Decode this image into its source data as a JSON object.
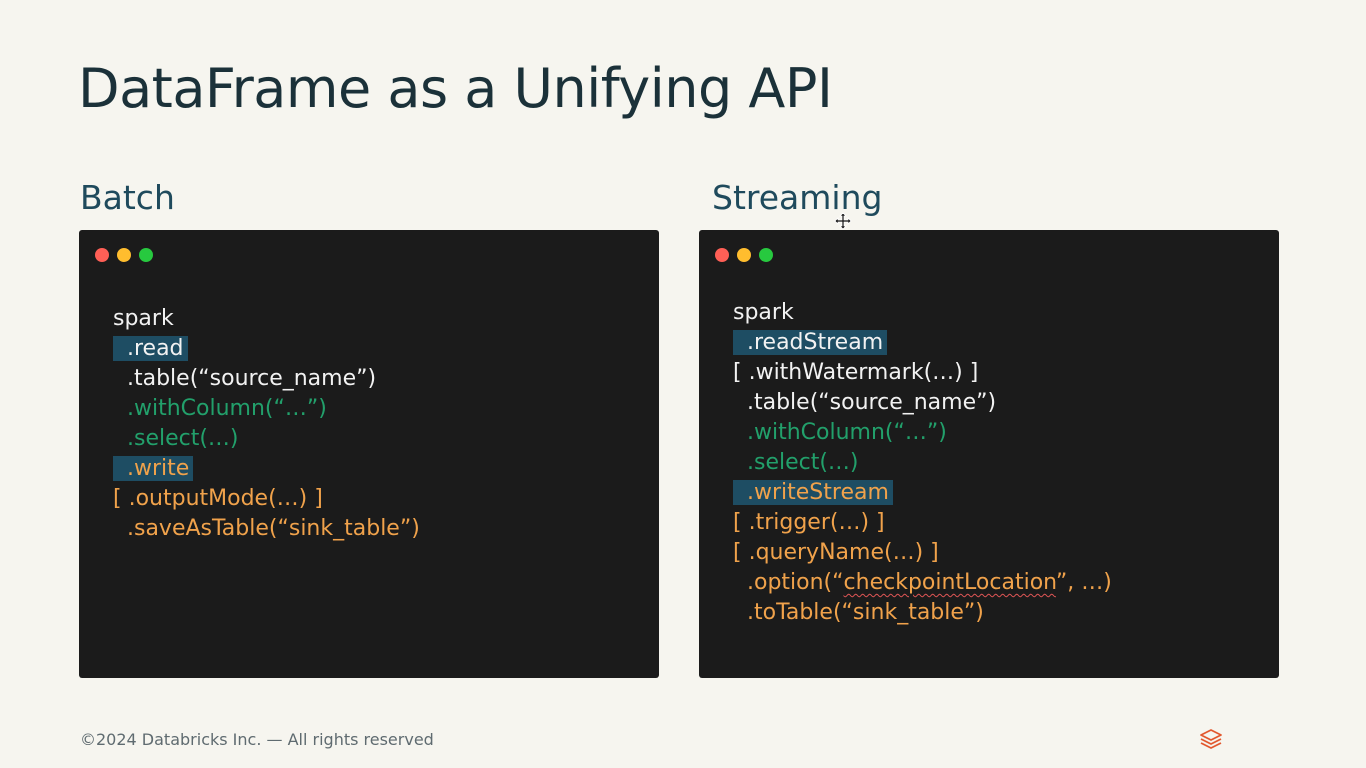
{
  "slide": {
    "title": "DataFrame as a Unifying API",
    "footer": "©2024 Databricks Inc. — All rights reserved",
    "logo_icon": "databricks-logo-icon"
  },
  "colors": {
    "background": "#f6f5ef",
    "title": "#1b3139",
    "heading": "#1f4a5c",
    "panel": "#1b1b1b",
    "highlight": "#1e4d63",
    "code_white": "#f2f2f2",
    "code_green": "#22a06b",
    "code_orange": "#f0a24b",
    "dot_red": "#ff5f56",
    "dot_yellow": "#ffbd2e",
    "dot_green": "#27c93f",
    "logo": "#e2582f"
  },
  "batch": {
    "heading": "Batch",
    "lines": [
      {
        "text": "spark",
        "color": "#f2f2f2",
        "highlight": false
      },
      {
        "text": "  .read",
        "color": "#f2f2f2",
        "highlight": true
      },
      {
        "text": "  .table(“source_name”)",
        "color": "#f2f2f2",
        "highlight": false
      },
      {
        "text": "  .withColumn(“…”)",
        "color": "#22a06b",
        "highlight": false
      },
      {
        "text": "  .select(…)",
        "color": "#22a06b",
        "highlight": false
      },
      {
        "text": "  .write",
        "color": "#f0a24b",
        "highlight": true
      },
      {
        "text": "[ .outputMode(…) ]",
        "color": "#f0a24b",
        "highlight": false
      },
      {
        "text": "  .saveAsTable(“sink_table”)",
        "color": "#f0a24b",
        "highlight": false
      }
    ]
  },
  "streaming": {
    "heading": "Streaming",
    "lines": [
      {
        "text": "spark",
        "color": "#f2f2f2",
        "highlight": false
      },
      {
        "text": "  .readStream",
        "color": "#f2f2f2",
        "highlight": true
      },
      {
        "text": "[ .withWatermark(…) ]",
        "color": "#f2f2f2",
        "highlight": false
      },
      {
        "text": "  .table(“source_name”)",
        "color": "#f2f2f2",
        "highlight": false
      },
      {
        "text": "  .withColumn(“…”)",
        "color": "#22a06b",
        "highlight": false
      },
      {
        "text": "  .select(…)",
        "color": "#22a06b",
        "highlight": false
      },
      {
        "text": "  .writeStream",
        "color": "#f0a24b",
        "highlight": true
      },
      {
        "text": "[ .trigger(…) ]",
        "color": "#f0a24b",
        "highlight": false
      },
      {
        "text": "[ .queryName(…) ]",
        "color": "#f0a24b",
        "highlight": false
      },
      {
        "text": "  .option(“checkpointLocation”, …)",
        "color": "#f0a24b",
        "highlight": false,
        "squiggle": "checkpointLocation"
      },
      {
        "text": "  .toTable(“sink_table”)",
        "color": "#f0a24b",
        "highlight": false
      }
    ]
  },
  "cursor_icon": "move-cursor-icon"
}
